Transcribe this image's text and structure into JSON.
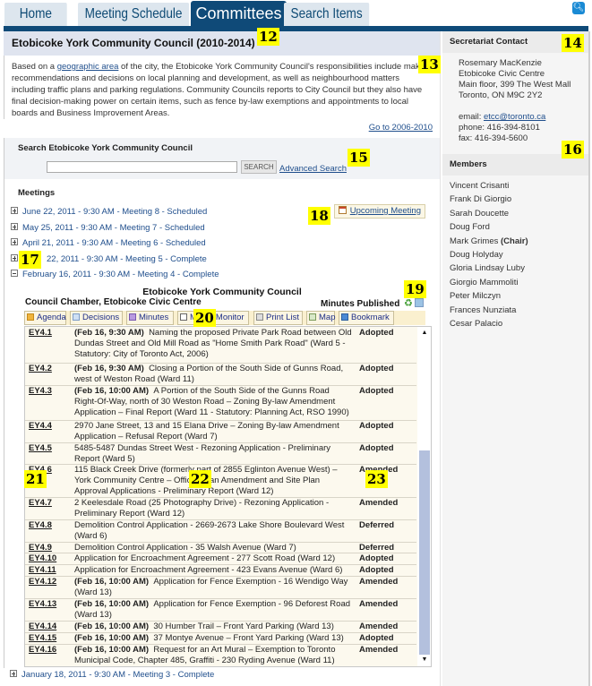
{
  "nav": {
    "tabs": [
      {
        "label": "Home"
      },
      {
        "label": "Meeting Schedule"
      },
      {
        "label": "Committees",
        "active": true
      },
      {
        "label": "Search Items"
      }
    ],
    "search_icon": "search-icon"
  },
  "main": {
    "title": "Etobicoke York Community Council (2010-2014)",
    "intro": {
      "before_link": "Based on a ",
      "link": "geographic area",
      "after_link": " of the city, the Etobicoke York Community Council's responsibilities include making recommendations and decisions on local planning and development, as well as neighbourhood matters including traffic plans and parking regulations. Community Councils reports to City Council but they also have final decision-making power on certain items, such as fence by-law exemptions and appointments to local boards and Business Improvement Areas."
    },
    "goto_link": "Go to 2006-2010",
    "search": {
      "title": "Search Etobicoke York Community Council",
      "input_value": "",
      "button": "SEARCH",
      "advanced": "Advanced Search"
    },
    "meetings_label": "Meetings",
    "upcoming_button": "Upcoming Meeting",
    "meetings": [
      {
        "label": "June 22, 2011 - 9:30 AM - Meeting 8 - Scheduled",
        "expanded": false
      },
      {
        "label": "May 25, 2011 - 9:30 AM - Meeting 7 - Scheduled",
        "expanded": false
      },
      {
        "label": "April 21, 2011 - 9:30 AM - Meeting 6 - Scheduled",
        "expanded": false
      },
      {
        "label": "March 22, 2011 - 9:30 AM - Meeting 5 - Complete",
        "visible_label": "22, 2011 - 9:30 AM - Meeting 5 - Complete",
        "expanded": false
      },
      {
        "label": "February 16, 2011 - 9:30 AM - Meeting 4 - Complete",
        "expanded": true
      }
    ],
    "detail": {
      "title": "Etobicoke York Community Council",
      "location": "Council Chamber, Etobicoke Civic Centre",
      "status": "Minutes Published",
      "toolbar": [
        {
          "label": "Agenda",
          "icon": "folder-icon"
        },
        {
          "label": "Decisions",
          "icon": "document-icon"
        },
        {
          "label": "Minutes",
          "icon": "minutes-icon"
        },
        {
          "label": "Meeting Monitor",
          "visible": "M",
          "icon": "monitor-icon"
        },
        {
          "label": "Monitor",
          "icon": ""
        },
        {
          "label": "Print List",
          "icon": "printer-icon"
        },
        {
          "label": "Map",
          "icon": "map-icon"
        },
        {
          "label": "Bookmark",
          "icon": "bookmark-icon"
        }
      ],
      "items": [
        {
          "id": "EY4.1",
          "time": "(Feb 16, 9:30 AM)",
          "desc": "Naming the proposed Private Park Road between Old Dundas Street and Old Mill Road as \"Home Smith Park Road\"  (Ward 5 - Statutory: City of Toronto Act, 2006)",
          "status": "Adopted"
        },
        {
          "id": "EY4.2",
          "time": "(Feb 16, 9:30 AM)",
          "desc": "Closing a Portion of the South Side of Gunns Road, west of Weston Road  (Ward 11)",
          "status": "Adopted"
        },
        {
          "id": "EY4.3",
          "time": "(Feb 16, 10:00 AM)",
          "desc": "A Portion of the South Side of the Gunns Road Right-Of-Way, north of 30 Weston Road – Zoning By-law Amendment Application – Final Report  (Ward 11 - Statutory: Planning Act, RSO 1990)",
          "status": "Adopted"
        },
        {
          "id": "EY4.4",
          "time": "",
          "desc": "2970 Jane Street, 13 and 15 Elana Drive – Zoning By-law Amendment Application – Refusal Report  (Ward 7)",
          "status": "Adopted"
        },
        {
          "id": "EY4.5",
          "time": "",
          "desc": "5485-5487 Dundas Street West - Rezoning Application - Preliminary Report  (Ward 5)",
          "status": "Adopted"
        },
        {
          "id": "EY4.6",
          "time": "",
          "desc": "115 Black Creek Drive (formerly part of 2855 Eglinton Avenue West) – York Community Centre – Official Plan Amendment and Site Plan Approval Applications - Preliminary Report  (Ward 12)",
          "status": "Amended"
        },
        {
          "id": "EY4.7",
          "time": "",
          "desc": "2 Keelesdale Road (25 Photography Drive) - Rezoning Application - Preliminary Report  (Ward 12)",
          "status": "Amended"
        },
        {
          "id": "EY4.8",
          "time": "",
          "desc": "Demolition Control Application - 2669-2673 Lake Shore Boulevard West (Ward 6)",
          "status": "Deferred"
        },
        {
          "id": "EY4.9",
          "time": "",
          "desc": "Demolition Control Application - 35 Walsh Avenue  (Ward 7)",
          "status": "Deferred"
        },
        {
          "id": "EY4.10",
          "time": "",
          "desc": "Application for Encroachment Agreement - 277 Scott Road  (Ward 12)",
          "status": "Adopted"
        },
        {
          "id": "EY4.11",
          "time": "",
          "desc": "Application for Encroachment Agreement - 423 Evans Avenue  (Ward 6)",
          "status": "Adopted"
        },
        {
          "id": "EY4.12",
          "time": "(Feb 16, 10:00 AM)",
          "desc": "Application for Fence Exemption - 16 Wendigo Way (Ward 13)",
          "status": "Amended"
        },
        {
          "id": "EY4.13",
          "time": "(Feb 16, 10:00 AM)",
          "desc": "Application for Fence Exemption - 96 Deforest Road (Ward 13)",
          "status": "Amended"
        },
        {
          "id": "EY4.14",
          "time": "(Feb 16, 10:00 AM)",
          "desc": "30 Humber Trail – Front Yard Parking  (Ward 13)",
          "status": "Amended"
        },
        {
          "id": "EY4.15",
          "time": "(Feb 16, 10:00 AM)",
          "desc": "37 Montye Avenue – Front Yard Parking  (Ward 13)",
          "status": "Adopted"
        },
        {
          "id": "EY4.16",
          "time": "(Feb 16, 10:00 AM)",
          "desc": "Request for an Art Mural – Exemption to Toronto Municipal Code, Chapter 485, Graffiti - 230 Ryding Avenue  (Ward 11)",
          "status": "Amended"
        }
      ]
    },
    "last_meeting": "January 18, 2011 - 9:30 AM - Meeting 3 - Complete"
  },
  "sidebar": {
    "contact_title": "Secretariat Contact",
    "contact": {
      "name": "Rosemary MacKenzie",
      "building": "Etobicoke Civic Centre",
      "address": "Main floor, 399 The West Mall",
      "city": "Toronto, ON M9C 2Y2",
      "email_label": "email: ",
      "email": "etcc@toronto.ca",
      "phone": "phone: 416-394-8101",
      "fax": "fax: 416-394-5600"
    },
    "members_title": "Members",
    "members": [
      {
        "name": "Vincent Crisanti",
        "role": ""
      },
      {
        "name": "Frank Di Giorgio",
        "role": ""
      },
      {
        "name": "Sarah Doucette",
        "role": ""
      },
      {
        "name": "Doug Ford",
        "role": ""
      },
      {
        "name": "Mark Grimes",
        "role": "(Chair)"
      },
      {
        "name": "Doug Holyday",
        "role": ""
      },
      {
        "name": "Gloria Lindsay Luby",
        "role": ""
      },
      {
        "name": "Giorgio Mammoliti",
        "role": ""
      },
      {
        "name": "Peter Milczyn",
        "role": ""
      },
      {
        "name": "Frances Nunziata",
        "role": ""
      },
      {
        "name": "Cesar Palacio",
        "role": ""
      }
    ]
  },
  "annotations": [
    "12",
    "13",
    "14",
    "15",
    "16",
    "17",
    "18",
    "19",
    "20",
    "21",
    "22",
    "23"
  ]
}
